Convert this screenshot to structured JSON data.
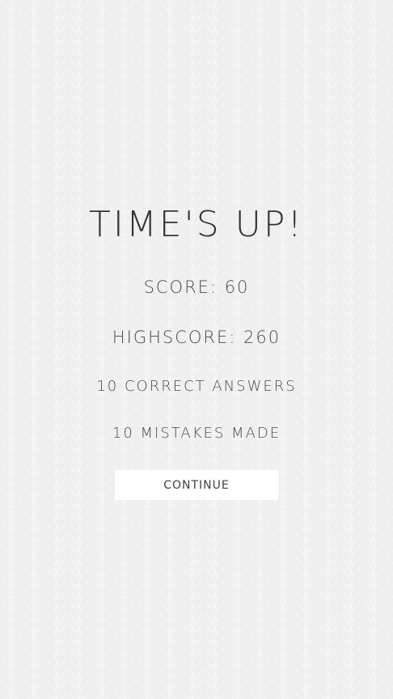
{
  "game_over": {
    "title": "TIME'S UP!",
    "score_text": "SCORE: 60",
    "highscore_text": "HIGHSCORE: 260",
    "correct_text": "10 CORRECT ANSWERS",
    "mistakes_text": "10 MISTAKES MADE",
    "continue_label": "CONTINUE"
  },
  "colors": {
    "background": "#efefef",
    "text": "#3a3a3a",
    "button_bg": "#ffffff"
  }
}
